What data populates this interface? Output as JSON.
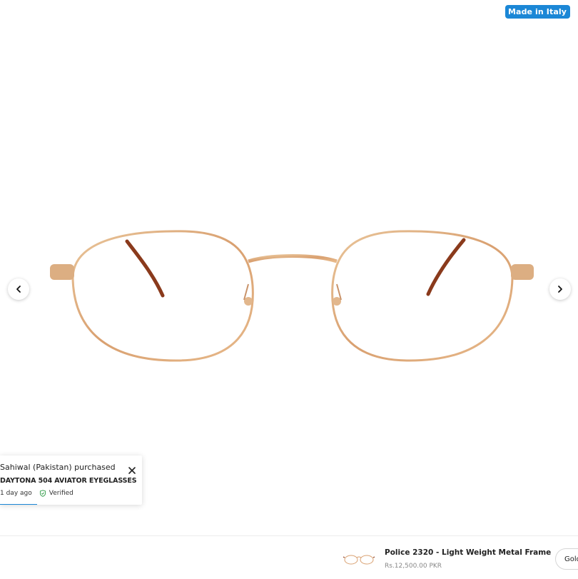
{
  "badge": {
    "label": "Made in Italy",
    "color": "#1b87d6"
  },
  "gallery": {
    "image": "gold-metal-oval-eyeglasses",
    "prev_icon": "chevron-left-icon",
    "next_icon": "chevron-right-icon"
  },
  "purchase_toast": {
    "location_text": "Sahiwal (Pakistan) purchased",
    "product_name": "DAYTONA 504 AVIATOR EYEGLASSES",
    "time_ago": "1 day ago",
    "verified_label": "Verified",
    "progress": 0.26
  },
  "sticky_bar": {
    "product_title": "Police 2320 - Light Weight Metal Frame",
    "price": "Rs.12,500.00 PKR",
    "variant_selected": "Gold"
  }
}
